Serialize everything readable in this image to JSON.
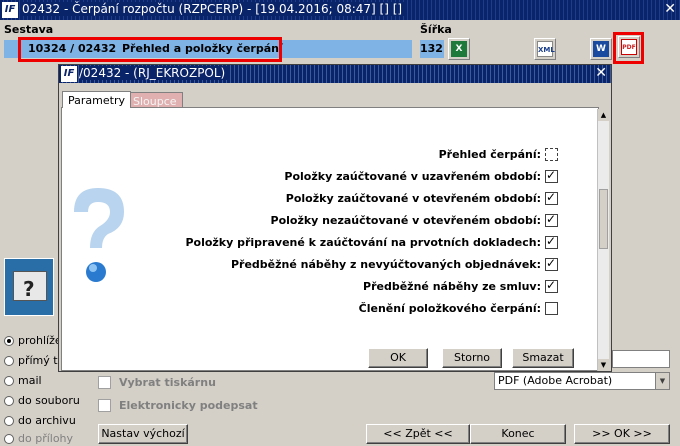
{
  "window": {
    "title": "02432 - Čerpání rozpočtu (RZPCERP) - [19.04.2016; 08:47]  [] []",
    "close": "✕"
  },
  "header": {
    "sestava_label": "Sestava",
    "sirka_label": "Šířka",
    "sestava_code": "10324 / 02432",
    "sestava_name": "Přehled a položky čerpání",
    "sirka_value": "132"
  },
  "toolbar": {
    "excel": "X",
    "xml": "XML",
    "word": "W",
    "pdf": "PDF"
  },
  "dialog": {
    "title": "/02432 - (RJ_EKROZPOL)",
    "close": "✕",
    "tabs": [
      {
        "label": "Parametry"
      },
      {
        "label": "Sloupce"
      }
    ],
    "checkboxes": [
      {
        "label": "Přehled čerpání:",
        "checked": false
      },
      {
        "label": "Položky zaúčtované v uzavřeném období:",
        "checked": true
      },
      {
        "label": "Položky zaúčtované v otevřeném období:",
        "checked": true
      },
      {
        "label": "Položky nezaúčtované v otevřeném období:",
        "checked": true
      },
      {
        "label": "Položky připravené k zaúčtování na prvotních dokladech:",
        "checked": true
      },
      {
        "label": "Předběžné náběhy z nevyúčtovaných objednávek:",
        "checked": true
      },
      {
        "label": "Předběžné náběhy ze smluv:",
        "checked": true
      },
      {
        "label": "Členění položkového čerpání:",
        "checked": false
      }
    ],
    "buttons": {
      "ok": "OK",
      "storno": "Storno",
      "smazat": "Smazat"
    }
  },
  "output": {
    "options": [
      {
        "label": "prohlížeč",
        "selected": true
      },
      {
        "label": "přímý tisk",
        "selected": false
      },
      {
        "label": "mail",
        "selected": false
      },
      {
        "label": "do souboru",
        "selected": false
      },
      {
        "label": "do archivu",
        "selected": false
      },
      {
        "label": "do přílohy",
        "selected": false
      }
    ],
    "vybrat_tiskarnu": "Vybrat tiskárnu",
    "elektronicky_podepsat": "Elektronicky podepsat",
    "printer_select": "PDF (Adobe Acrobat)"
  },
  "footer": {
    "nastav_vychozi": "Nastav výchozí",
    "zpet": "<< Zpět <<",
    "konec": "Konec",
    "ok_next": ">> OK >>"
  }
}
